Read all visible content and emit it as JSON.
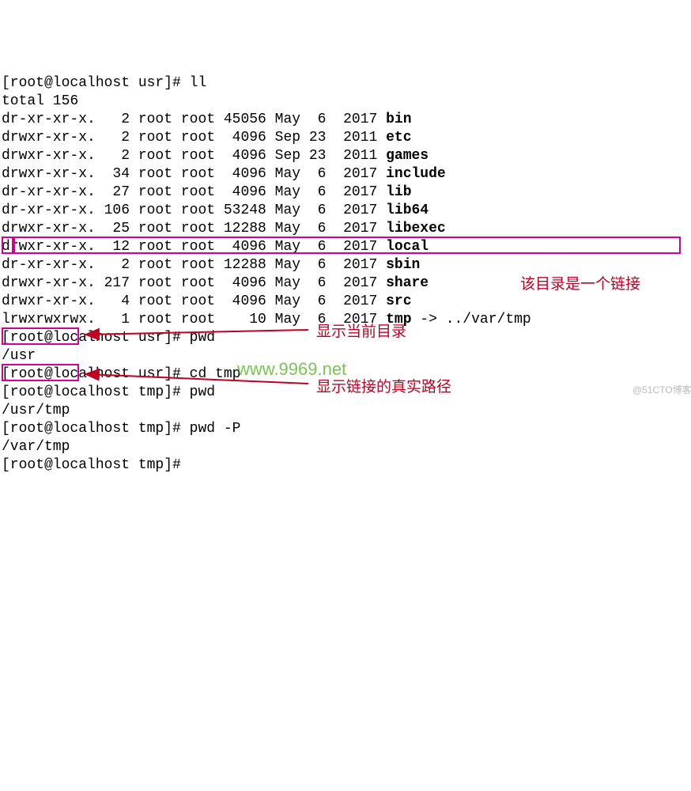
{
  "prompt": "[root@localhost usr]# ",
  "prompt_tmp": "[root@localhost tmp]# ",
  "cmd_ll": "ll",
  "total_line": "total 156",
  "listing": [
    {
      "perm": "dr-xr-xr-x.",
      "links": "2",
      "user": "root",
      "group": "root",
      "size": "45056",
      "month": "May",
      "day": "6",
      "year": "2017",
      "name": "bin"
    },
    {
      "perm": "drwxr-xr-x.",
      "links": "2",
      "user": "root",
      "group": "root",
      "size": "4096",
      "month": "Sep",
      "day": "23",
      "year": "2011",
      "name": "etc"
    },
    {
      "perm": "drwxr-xr-x.",
      "links": "2",
      "user": "root",
      "group": "root",
      "size": "4096",
      "month": "Sep",
      "day": "23",
      "year": "2011",
      "name": "games"
    },
    {
      "perm": "drwxr-xr-x.",
      "links": "34",
      "user": "root",
      "group": "root",
      "size": "4096",
      "month": "May",
      "day": "6",
      "year": "2017",
      "name": "include"
    },
    {
      "perm": "dr-xr-xr-x.",
      "links": "27",
      "user": "root",
      "group": "root",
      "size": "4096",
      "month": "May",
      "day": "6",
      "year": "2017",
      "name": "lib"
    },
    {
      "perm": "dr-xr-xr-x.",
      "links": "106",
      "user": "root",
      "group": "root",
      "size": "53248",
      "month": "May",
      "day": "6",
      "year": "2017",
      "name": "lib64"
    },
    {
      "perm": "drwxr-xr-x.",
      "links": "25",
      "user": "root",
      "group": "root",
      "size": "12288",
      "month": "May",
      "day": "6",
      "year": "2017",
      "name": "libexec"
    },
    {
      "perm": "drwxr-xr-x.",
      "links": "12",
      "user": "root",
      "group": "root",
      "size": "4096",
      "month": "May",
      "day": "6",
      "year": "2017",
      "name": "local"
    },
    {
      "perm": "dr-xr-xr-x.",
      "links": "2",
      "user": "root",
      "group": "root",
      "size": "12288",
      "month": "May",
      "day": "6",
      "year": "2017",
      "name": "sbin"
    },
    {
      "perm": "drwxr-xr-x.",
      "links": "217",
      "user": "root",
      "group": "root",
      "size": "4096",
      "month": "May",
      "day": "6",
      "year": "2017",
      "name": "share"
    },
    {
      "perm": "drwxr-xr-x.",
      "links": "4",
      "user": "root",
      "group": "root",
      "size": "4096",
      "month": "May",
      "day": "6",
      "year": "2017",
      "name": "src"
    }
  ],
  "symlink": {
    "perm": "lrwxrwxrwx.",
    "links": "1",
    "user": "root",
    "group": "root",
    "size": "10",
    "month": "May",
    "day": "6",
    "year": "2017",
    "name": "tmp",
    "arrow": " -> ",
    "target": "../var/tmp"
  },
  "cmd_pwd": "pwd",
  "out_pwd1": "/usr",
  "cmd_cd": "cd tmp",
  "out_pwd2": "/usr/tmp",
  "cmd_pwdP": "pwd -P",
  "out_pwd3": "/var/tmp",
  "ann_link": "该目录是一个链接",
  "ann_cur": "显示当前目录",
  "ann_real": "显示链接的真实路径",
  "wm1": "www.9969.net",
  "wm2": "@51CTO博客"
}
